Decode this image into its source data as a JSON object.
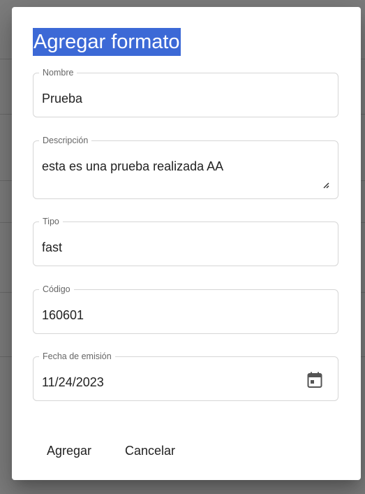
{
  "dialog": {
    "title": "Agregar formato",
    "fields": {
      "nombre": {
        "label": "Nombre",
        "value": "Prueba"
      },
      "descripcion": {
        "label": "Descripción",
        "value": "esta es una prueba realizada AA"
      },
      "tipo": {
        "label": "Tipo",
        "value": "fast"
      },
      "codigo": {
        "label": "Código",
        "value": "160601"
      },
      "fecha": {
        "label": "Fecha de emisión",
        "value": "11/24/2023",
        "icon": "calendar-icon"
      }
    },
    "actions": {
      "agregar": "Agregar",
      "cancelar": "Cancelar"
    }
  },
  "colors": {
    "title_highlight": "#3c69d6",
    "backdrop": "#7d7d7d"
  }
}
